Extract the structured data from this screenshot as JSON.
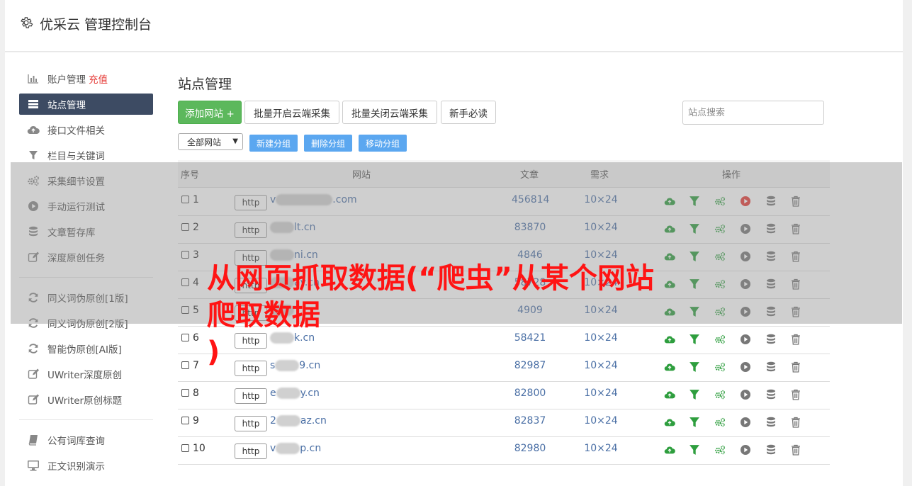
{
  "header": {
    "title": "优采云 管理控制台"
  },
  "sidebar": {
    "items": [
      {
        "label": "账户管理",
        "extra": "充值",
        "icon": "bar-chart-icon"
      },
      {
        "label": "站点管理",
        "icon": "server-list-icon",
        "active": true
      },
      {
        "label": "接口文件相关",
        "icon": "cloud-upload-icon"
      },
      {
        "label": "栏目与关键词",
        "icon": "filter-icon"
      },
      {
        "label": "采集细节设置",
        "icon": "gears-icon"
      },
      {
        "label": "手动运行测试",
        "icon": "play-circle-icon"
      },
      {
        "label": "文章暂存库",
        "icon": "database-icon"
      },
      {
        "label": "深度原创任务",
        "icon": "edit-icon"
      },
      {
        "label": "同义词伪原创[1版]",
        "icon": "refresh-icon"
      },
      {
        "label": "同义词伪原创[2版]",
        "icon": "refresh-icon"
      },
      {
        "label": "智能伪原创[AI版]",
        "icon": "refresh-icon"
      },
      {
        "label": "UWriter深度原创",
        "icon": "edit-icon"
      },
      {
        "label": "UWriter原创标题",
        "icon": "edit-icon"
      },
      {
        "label": "公有词库查询",
        "icon": "book-icon"
      },
      {
        "label": "正文识别演示",
        "icon": "monitor-icon"
      }
    ]
  },
  "main": {
    "title": "站点管理",
    "buttons": {
      "add_site": "添加网站 +",
      "batch_open": "批量开启云端采集",
      "batch_close": "批量关闭云端采集",
      "newbie": "新手必读"
    },
    "search_placeholder": "站点搜索",
    "group_select": "全部网站",
    "group_buttons": {
      "new_group": "新建分组",
      "delete_group": "删除分组",
      "move_group": "移动分组"
    },
    "table": {
      "headers": {
        "index": "序号",
        "site": "网站",
        "articles": "文章",
        "demand": "需求",
        "actions": "操作"
      },
      "rows": [
        {
          "index": "1",
          "scheme": "http",
          "site_prefix": "v",
          "site_suffix": ".com",
          "articles": "456814",
          "demand": "10×24",
          "running": true
        },
        {
          "index": "2",
          "scheme": "http",
          "site_prefix": "",
          "site_suffix": "lt.cn",
          "articles": "83870",
          "demand": "10×24",
          "running": false
        },
        {
          "index": "3",
          "scheme": "http",
          "site_prefix": "",
          "site_suffix": "ni.cn",
          "articles": "4846",
          "demand": "10×24",
          "running": false
        },
        {
          "index": "4",
          "scheme": "http",
          "site_prefix": "",
          "site_suffix": "ay.cn",
          "articles": "58728",
          "demand": "10×24",
          "running": false
        },
        {
          "index": "5",
          "scheme": "http",
          "site_prefix": "",
          "site_suffix": "",
          "articles": "4909",
          "demand": "10×24",
          "running": false
        },
        {
          "index": "6",
          "scheme": "http",
          "site_prefix": "",
          "site_suffix": "k.cn",
          "articles": "58421",
          "demand": "10×24",
          "running": false
        },
        {
          "index": "7",
          "scheme": "http",
          "site_prefix": "s",
          "site_suffix": "9.cn",
          "articles": "82987",
          "demand": "10×24",
          "running": false
        },
        {
          "index": "8",
          "scheme": "http",
          "site_prefix": "e",
          "site_suffix": "y.cn",
          "articles": "82800",
          "demand": "10×24",
          "running": false
        },
        {
          "index": "9",
          "scheme": "http",
          "site_prefix": "2",
          "site_suffix": "az.cn",
          "articles": "82837",
          "demand": "10×24",
          "running": false
        },
        {
          "index": "10",
          "scheme": "http",
          "site_prefix": "v",
          "site_suffix": "p.cn",
          "articles": "82980",
          "demand": "10×24",
          "running": false
        }
      ]
    }
  },
  "overlay_caption": {
    "line1": "从网页抓取数据(“爬虫”从某个网站",
    "line2": "爬取数据",
    "line3": ")"
  },
  "colors": {
    "accent_green": "#5cb85c",
    "sidebar_active": "#3d4b63",
    "link_blue": "#4a6fa5",
    "icon_green": "#2e9e3e",
    "play_red": "#e53935",
    "overlay_text": "#ff1414"
  }
}
